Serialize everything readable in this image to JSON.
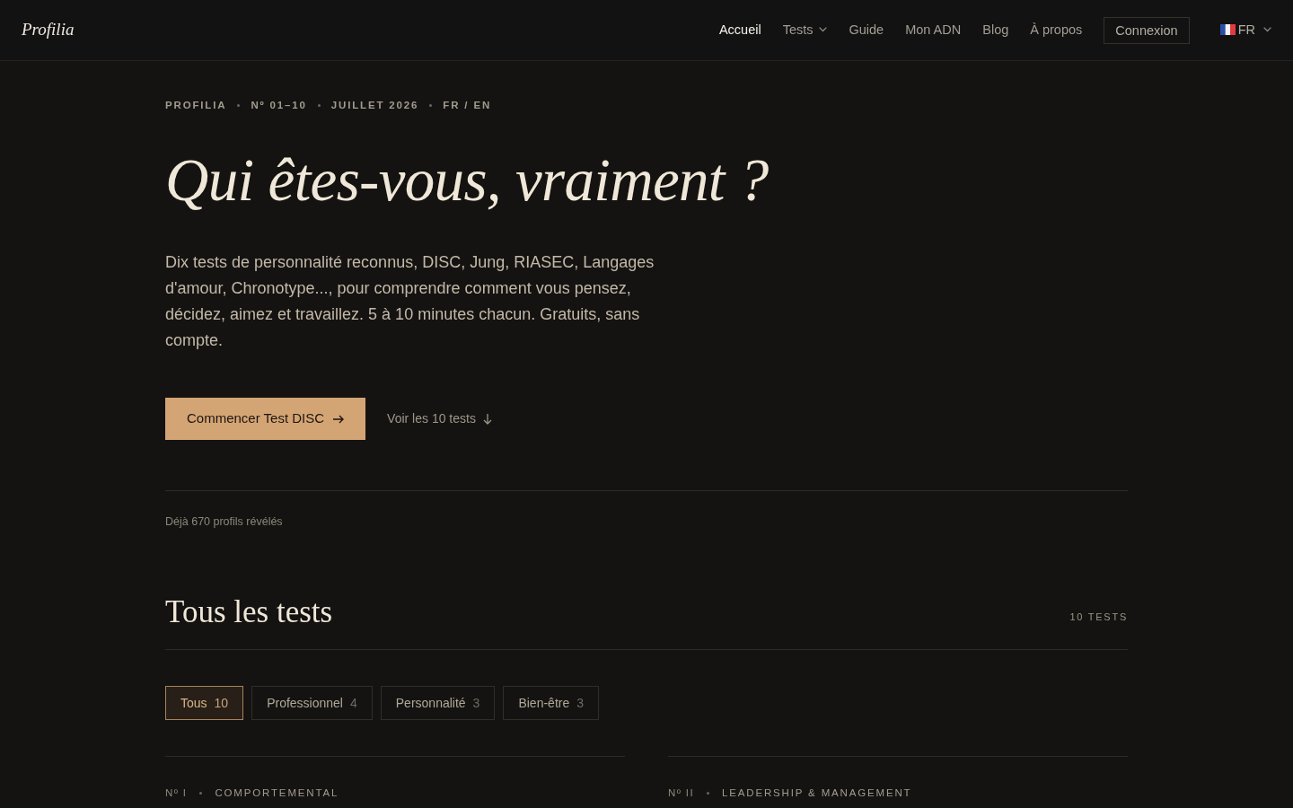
{
  "navbar": {
    "logo": "Profilia",
    "links": [
      {
        "label": "Accueil",
        "selected": true,
        "dropdown": false
      },
      {
        "label": "Tests",
        "selected": false,
        "dropdown": true
      },
      {
        "label": "Guide",
        "selected": false,
        "dropdown": false
      },
      {
        "label": "Mon ADN",
        "selected": false,
        "dropdown": false
      },
      {
        "label": "Blog",
        "selected": false,
        "dropdown": false
      },
      {
        "label": "À propos",
        "selected": false,
        "dropdown": false
      }
    ],
    "login": "Connexion",
    "language": "FR"
  },
  "hero": {
    "eyebrow": [
      "PROFILIA",
      "Nº 01–10",
      "JUILLET 2026",
      "FR / EN"
    ],
    "title": "Qui êtes-vous, vraiment ?",
    "lead": "Dix tests de personnalité reconnus, DISC, Jung, RIASEC, Langages d'amour, Chronotype..., pour comprendre comment vous pensez, décidez, aimez et travaillez. 5 à 10 minutes chacun. Gratuits, sans compte.",
    "primary_button": "Commencer Test DISC",
    "secondary_link": "Voir les 10 tests",
    "stat": "Déjà 670 profils révélés"
  },
  "tests_section": {
    "title": "Tous les tests",
    "count": "10 TESTS",
    "filters": [
      {
        "label": "Tous",
        "count": "10",
        "selected": true
      },
      {
        "label": "Professionnel",
        "count": "4",
        "selected": false
      },
      {
        "label": "Personnalité",
        "count": "3",
        "selected": false
      },
      {
        "label": "Bien-être",
        "count": "3",
        "selected": false
      }
    ],
    "cards": [
      {
        "number": "Nº I",
        "category": "COMPORTEMENTAL"
      },
      {
        "number": "Nº II",
        "category": "LEADERSHIP & MANAGEMENT"
      }
    ]
  }
}
